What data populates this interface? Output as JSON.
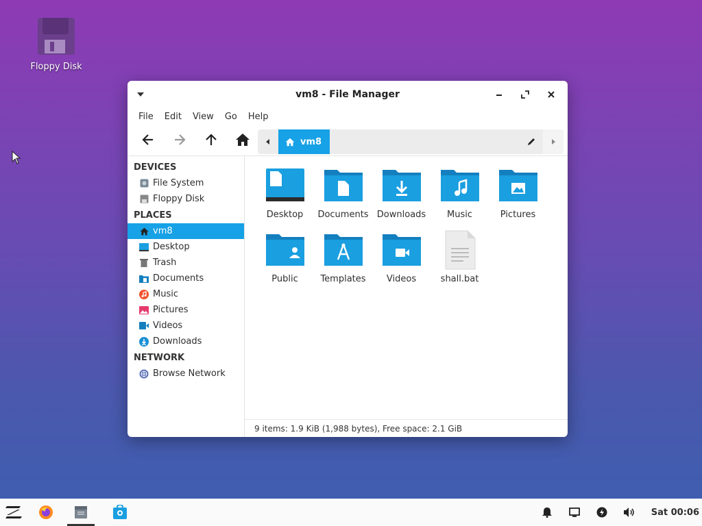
{
  "desktop": {
    "icons": [
      {
        "label": "Floppy Disk",
        "icon": "floppy-disk-icon"
      }
    ]
  },
  "window": {
    "title": "vm8 - File Manager",
    "controls": {
      "minimize": "minimize-icon",
      "maximize": "maximize-icon",
      "close": "close-icon"
    }
  },
  "menubar": [
    "File",
    "Edit",
    "View",
    "Go",
    "Help"
  ],
  "toolbar": {
    "buttons": [
      "back-arrow-icon",
      "forward-arrow-icon",
      "up-arrow-icon",
      "home-icon"
    ],
    "path": {
      "crumb": "vm8",
      "crumb_icon": "home-icon",
      "edit_icon": "pencil-icon"
    }
  },
  "sidebar": {
    "sections": [
      {
        "heading": "DEVICES",
        "items": [
          {
            "label": "File System",
            "icon": "drive-icon"
          },
          {
            "label": "Floppy Disk",
            "icon": "floppy-disk-icon"
          }
        ]
      },
      {
        "heading": "PLACES",
        "items": [
          {
            "label": "vm8",
            "icon": "home-icon",
            "active": true
          },
          {
            "label": "Desktop",
            "icon": "desktop-icon"
          },
          {
            "label": "Trash",
            "icon": "trash-icon"
          },
          {
            "label": "Documents",
            "icon": "documents-folder-icon"
          },
          {
            "label": "Music",
            "icon": "music-icon"
          },
          {
            "label": "Pictures",
            "icon": "pictures-icon"
          },
          {
            "label": "Videos",
            "icon": "videos-icon"
          },
          {
            "label": "Downloads",
            "icon": "downloads-icon"
          }
        ]
      },
      {
        "heading": "NETWORK",
        "items": [
          {
            "label": "Browse Network",
            "icon": "network-globe-icon"
          }
        ]
      }
    ]
  },
  "files": [
    {
      "label": "Desktop",
      "icon": "desktop-folder-icon"
    },
    {
      "label": "Documents",
      "icon": "documents-folder-icon"
    },
    {
      "label": "Downloads",
      "icon": "downloads-folder-icon"
    },
    {
      "label": "Music",
      "icon": "music-folder-icon"
    },
    {
      "label": "Pictures",
      "icon": "pictures-folder-icon"
    },
    {
      "label": "Public",
      "icon": "public-folder-icon"
    },
    {
      "label": "Templates",
      "icon": "templates-folder-icon"
    },
    {
      "label": "Videos",
      "icon": "videos-folder-icon"
    },
    {
      "label": "shall.bat",
      "icon": "text-file-icon"
    }
  ],
  "status": "9 items: 1.9 KiB (1,988 bytes), Free space: 2.1 GiB",
  "taskbar": {
    "launchers": [
      "zorin-menu-icon",
      "firefox-icon",
      "file-manager-icon",
      "software-store-icon"
    ],
    "tray": [
      "bell-icon",
      "display-icon",
      "power-icon",
      "volume-icon"
    ],
    "clock": "Sat 00:06"
  },
  "colors": {
    "accent": "#17a1e6",
    "folder": "#1a9fe0",
    "folder_dark": "#137fbf"
  }
}
